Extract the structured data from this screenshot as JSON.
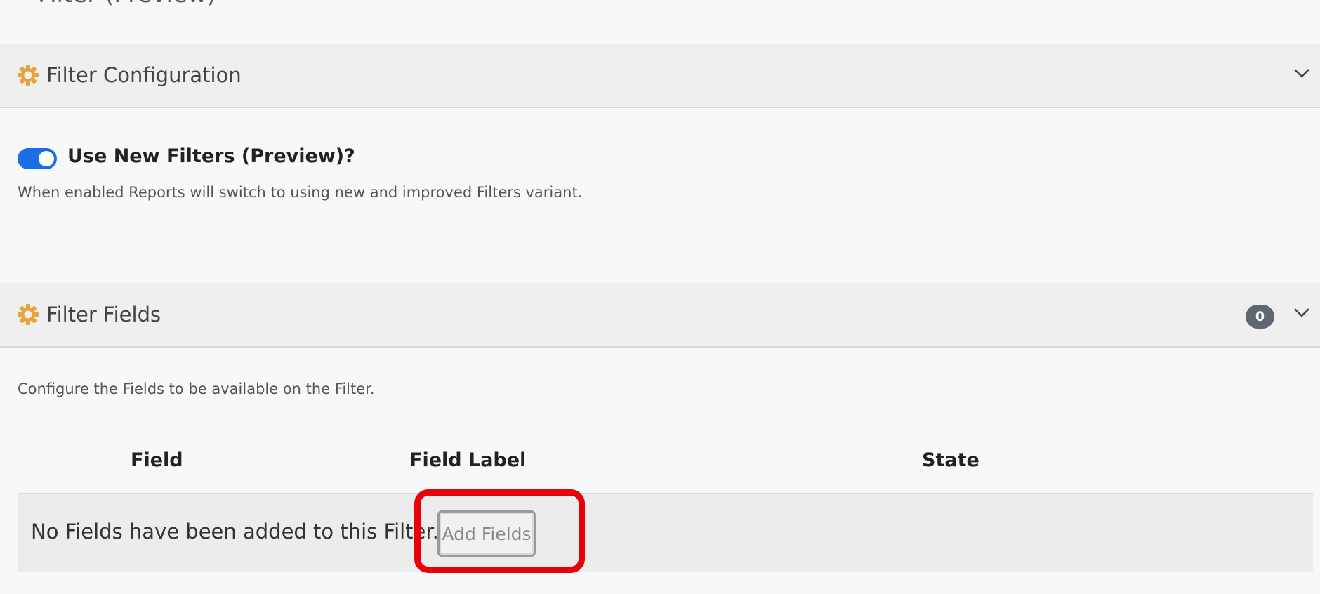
{
  "page": {
    "title": "Filter (Preview)"
  },
  "filter_configuration": {
    "title": "Filter Configuration",
    "toggle_label": "Use New Filters (Preview)?",
    "toggle_on": true,
    "toggle_help": "When enabled Reports will switch to using new and improved Filters variant."
  },
  "filter_fields": {
    "title": "Filter Fields",
    "count": "0",
    "description": "Configure the Fields to be available on the Filter.",
    "columns": [
      "Field",
      "Field Label",
      "State"
    ],
    "empty_message": "No Fields have been added to this Filter.",
    "add_button": "Add Fields"
  },
  "colors": {
    "accent": "#1a6fe8",
    "gear": "#e8a43a",
    "highlight": "#e8000b",
    "badge": "#5e6670"
  },
  "icons": [
    "back-arrow-icon",
    "gear-icon",
    "chevron-down-icon"
  ]
}
